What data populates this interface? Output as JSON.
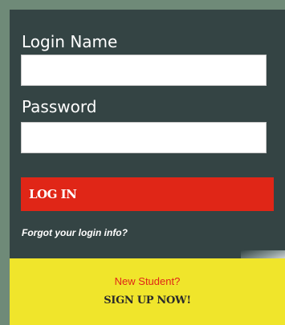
{
  "login": {
    "name_label": "Login Name",
    "name_value": "",
    "password_label": "Password",
    "password_value": "",
    "button_label": "LOG IN",
    "forgot_link": "Forgot your login info?"
  },
  "signup": {
    "subtitle": "New Student?",
    "cta": "SIGN UP NOW!"
  },
  "colors": {
    "panel": "#344444",
    "frame": "#6f8a78",
    "login_button": "#e02617",
    "signup_panel": "#f0e52b"
  }
}
